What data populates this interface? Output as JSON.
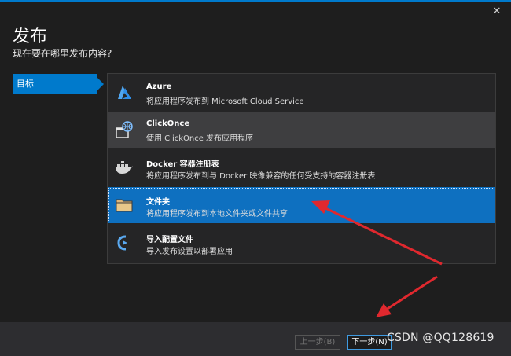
{
  "dialog": {
    "title": "发布",
    "subtitle": "现在要在哪里发布内容?"
  },
  "sidebar": {
    "items": [
      {
        "label": "目标"
      }
    ]
  },
  "options": [
    {
      "title": "Azure",
      "description": "将应用程序发布到 Microsoft Cloud Service",
      "icon": "azure-icon",
      "state": "normal"
    },
    {
      "title": "ClickOnce",
      "description": "使用 ClickOnce 发布应用程序",
      "icon": "clickonce-icon",
      "state": "hover"
    },
    {
      "title": "Docker 容器注册表",
      "description": "将应用程序发布到与 Docker 映像兼容的任何受支持的容器注册表",
      "icon": "docker-icon",
      "state": "normal"
    },
    {
      "title": "文件夹",
      "description": "将应用程序发布到本地文件夹或文件共享",
      "icon": "folder-icon",
      "state": "selected"
    },
    {
      "title": "导入配置文件",
      "description": "导入发布设置以部署应用",
      "icon": "import-icon",
      "state": "normal"
    }
  ],
  "footer": {
    "prev_label": "上一步(B)",
    "next_label": "下一步(N)"
  },
  "watermark": "CSDN @QQ128619",
  "colors": {
    "accent": "#007acc",
    "selected": "#0e70c0",
    "annotation_arrow": "#e0282e"
  }
}
